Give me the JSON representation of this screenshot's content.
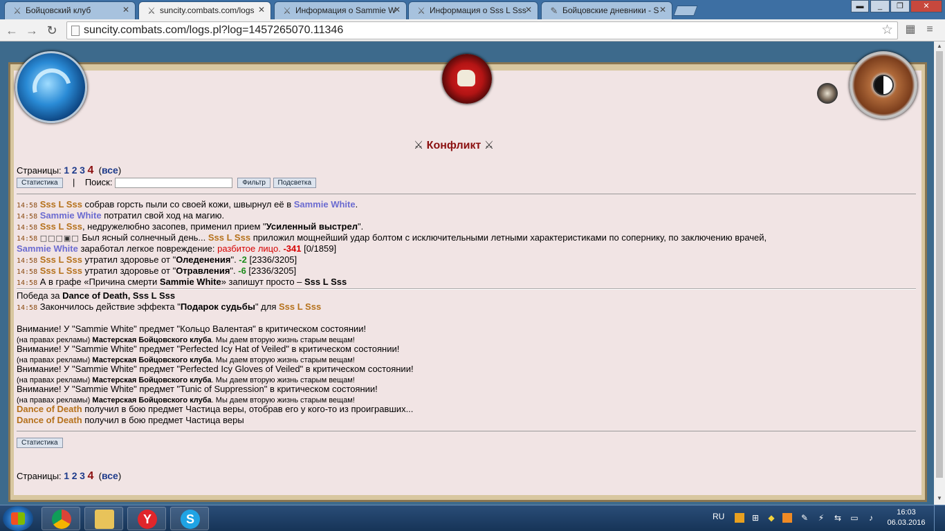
{
  "tabs": [
    {
      "label": "Бойцовский клуб",
      "icon": "swords-icon"
    },
    {
      "label": "suncity.combats.com/logs",
      "icon": "swords-icon"
    },
    {
      "label": "Информация о Sammie W",
      "icon": "swords-icon"
    },
    {
      "label": "Информация о Sss L Sss",
      "icon": "swords-icon"
    },
    {
      "label": "Бойцовские дневники - S",
      "icon": "feather-icon"
    }
  ],
  "address": {
    "url": "suncity.combats.com/logs.pl?log=1457265070.11346"
  },
  "page": {
    "title": "Конфликт",
    "pages_label": "Страницы:",
    "pages": [
      "1",
      "2",
      "3"
    ],
    "current_page": "4",
    "all_label": "все",
    "stats_button": "Статистика",
    "separator": "|",
    "search_label": "Поиск:",
    "search_value": "",
    "filter_button": "Фильтр",
    "highlight_button": "Подсветка"
  },
  "log": {
    "time": "14:58",
    "fighter1": "Sss L Sss",
    "fighter2": "Sammie White",
    "line1_text": " собрав горсть пыли со своей кожи, швырнул её в ",
    "line1_end": ".",
    "line2_text": " потратил свой ход на магию.",
    "line3_text": ", недружелюбно засопев, применил прием \"",
    "line3_skill": "Усиленный выстрел",
    "line3_end": "\".",
    "line4_squares": "□□□▣□",
    "line4_text1": " Был ясный солнечный день... ",
    "line4_text2": " приложил мощнейший удар болтом с исключительными летными характеристиками по сопернику, по заключению врачей,",
    "line5_text": " заработал легкое повреждение: ",
    "line5_injury": "разбитое лицо",
    "line5_dot": ". ",
    "line5_damage": "-341",
    "line5_hp": " [0/1859]",
    "line6_text": " утратил здоровье от \"",
    "line6_effect": "Оледенения",
    "line6_mid": "\". ",
    "line6_damage": "-2",
    "line6_hp": " [2336/3205]",
    "line7_text": " утратил здоровье от \"",
    "line7_effect": "Отравления",
    "line7_mid": "\". ",
    "line7_damage": "-6",
    "line7_hp": " [2336/3205]",
    "line8_text1": " А в графе «Причина смерти ",
    "line8_text2": "» запишут просто – ",
    "victory_label": "Победа за ",
    "victory_names": "Dance of Death, Sss L Sss",
    "effect_text1": " Закончилось действие эффекта \"",
    "effect_name": "Подарок судьбы",
    "effect_text2": "\" для "
  },
  "notices": {
    "warnings": [
      "Внимание! У \"Sammie White\" предмет \"Кольцо Валентая\" в критическом состоянии!",
      "Внимание! У \"Sammie White\" предмет \"Perfected Icy Hat of Veiled\" в критическом состоянии!",
      "Внимание! У \"Sammie White\" предмет \"Perfected Icy Gloves of Veiled\" в критическом состоянии!",
      "Внимание! У \"Sammie White\" предмет \"Tunic of Suppression\" в критическом состоянии!"
    ],
    "ad_prefix": "(на правах рекламы) ",
    "ad_name": "Мастерская Бойцовского клуба",
    "ad_suffix": ". Мы даем вторую жизнь старым вещам!",
    "drop_player": "Dance of Death",
    "drop1": " получил в бою предмет Частица веры, отобрав его у кого-то из проигравших...",
    "drop2": " получил в бою предмет Частица веры"
  },
  "taskbar": {
    "lang": "RU",
    "time": "16:03",
    "date": "06.03.2016",
    "apps": [
      "chrome-icon",
      "explorer-icon",
      "yandex-icon",
      "skype-icon"
    ],
    "yandex_letter": "Y",
    "skype_letter": "S"
  }
}
